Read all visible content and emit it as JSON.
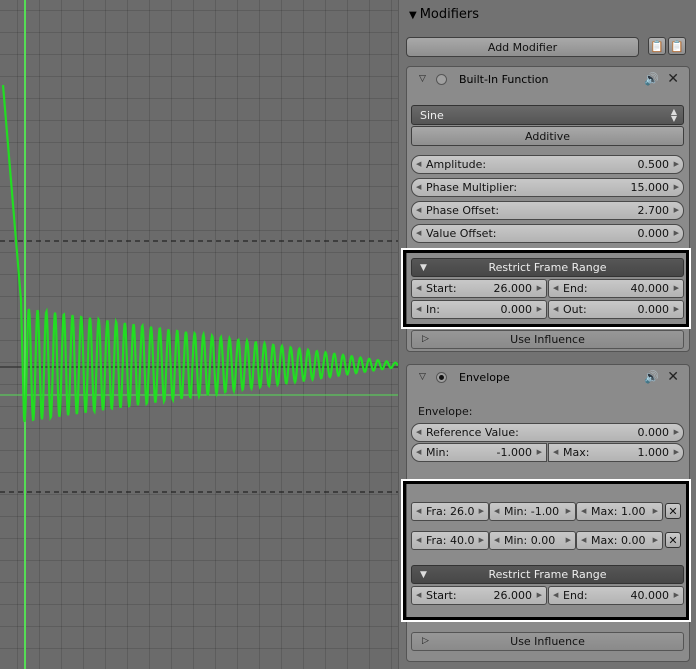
{
  "graph": {
    "cursor_color": "#55dd55",
    "curve_color": "#22dd22"
  },
  "panel": {
    "title": "Modifiers",
    "add_modifier": "Add Modifier"
  },
  "builtin": {
    "name": "Built-In Function",
    "function": "Sine",
    "mode": "Additive",
    "amplitude_label": "Amplitude:",
    "amplitude": "0.500",
    "phase_mult_label": "Phase Multiplier:",
    "phase_mult": "15.000",
    "phase_offset_label": "Phase Offset:",
    "phase_offset": "2.700",
    "value_offset_label": "Value Offset:",
    "value_offset": "0.000",
    "restrict_label": "Restrict Frame Range",
    "start_label": "Start:",
    "start": "26.000",
    "end_label": "End:",
    "end": "40.000",
    "in_label": "In:",
    "in": "0.000",
    "out_label": "Out:",
    "out": "0.000",
    "use_influence": "Use Influence"
  },
  "envelope": {
    "name": "Envelope",
    "section_label": "Envelope:",
    "ref_label": "Reference Value:",
    "ref": "0.000",
    "min_label": "Min:",
    "min": "-1.000",
    "max_label": "Max:",
    "max": "1.000",
    "points": [
      {
        "fra": "Fra: 26.0",
        "min": "Min:  -1.00",
        "max": "Max:  1.00"
      },
      {
        "fra": "Fra: 40.0",
        "min": "Min:   0.00",
        "max": "Max:  0.00"
      }
    ],
    "restrict_label": "Restrict Frame Range",
    "start_label": "Start:",
    "start": "26.000",
    "end_label": "End:",
    "end": "40.000",
    "use_influence": "Use Influence"
  }
}
